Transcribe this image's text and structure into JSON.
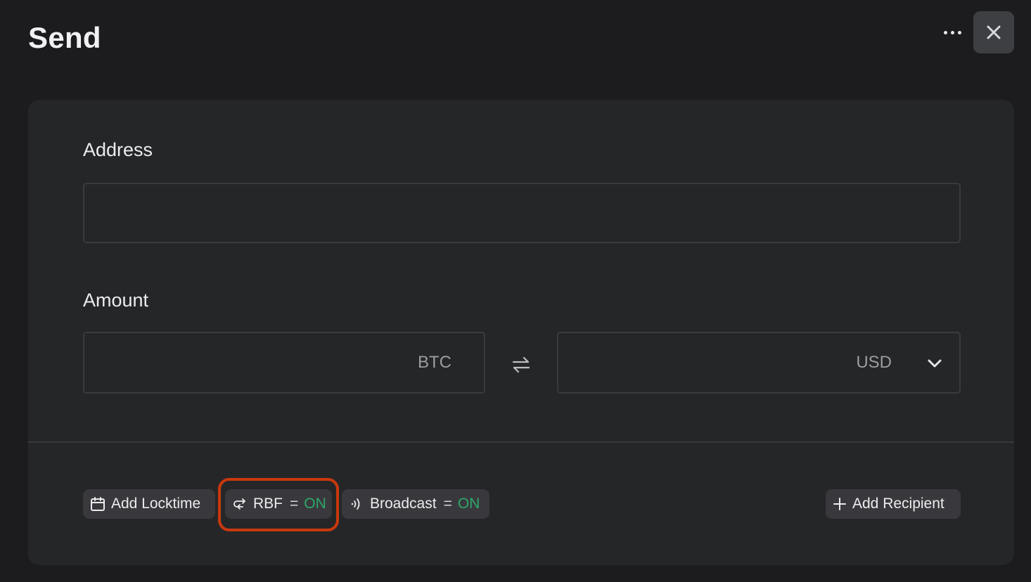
{
  "header": {
    "title": "Send",
    "more_icon": "more-horizontal-icon",
    "close_icon": "close-icon"
  },
  "form": {
    "address": {
      "label": "Address",
      "value": "",
      "placeholder": ""
    },
    "amount": {
      "label": "Amount",
      "btc_value": "",
      "btc_unit": "BTC",
      "usd_value": "",
      "usd_unit": "USD",
      "swap_icon": "swap-arrows-icon",
      "currency_dropdown_icon": "chevron-down-icon"
    }
  },
  "options": {
    "locktime": {
      "label": "Add Locktime",
      "icon": "calendar-icon"
    },
    "rbf": {
      "label": "RBF",
      "eq": "=",
      "value": "ON",
      "icon": "replace-arrows-icon"
    },
    "broadcast": {
      "label": "Broadcast",
      "eq": "=",
      "value": "ON",
      "icon": "broadcast-icon"
    },
    "add_recipient": {
      "label": "Add Recipient",
      "icon": "plus-icon"
    }
  },
  "colors": {
    "background": "#1c1c1e",
    "card": "#252628",
    "chip": "#39393d",
    "on_status": "#2ea86a",
    "highlight": "#c8380e"
  }
}
